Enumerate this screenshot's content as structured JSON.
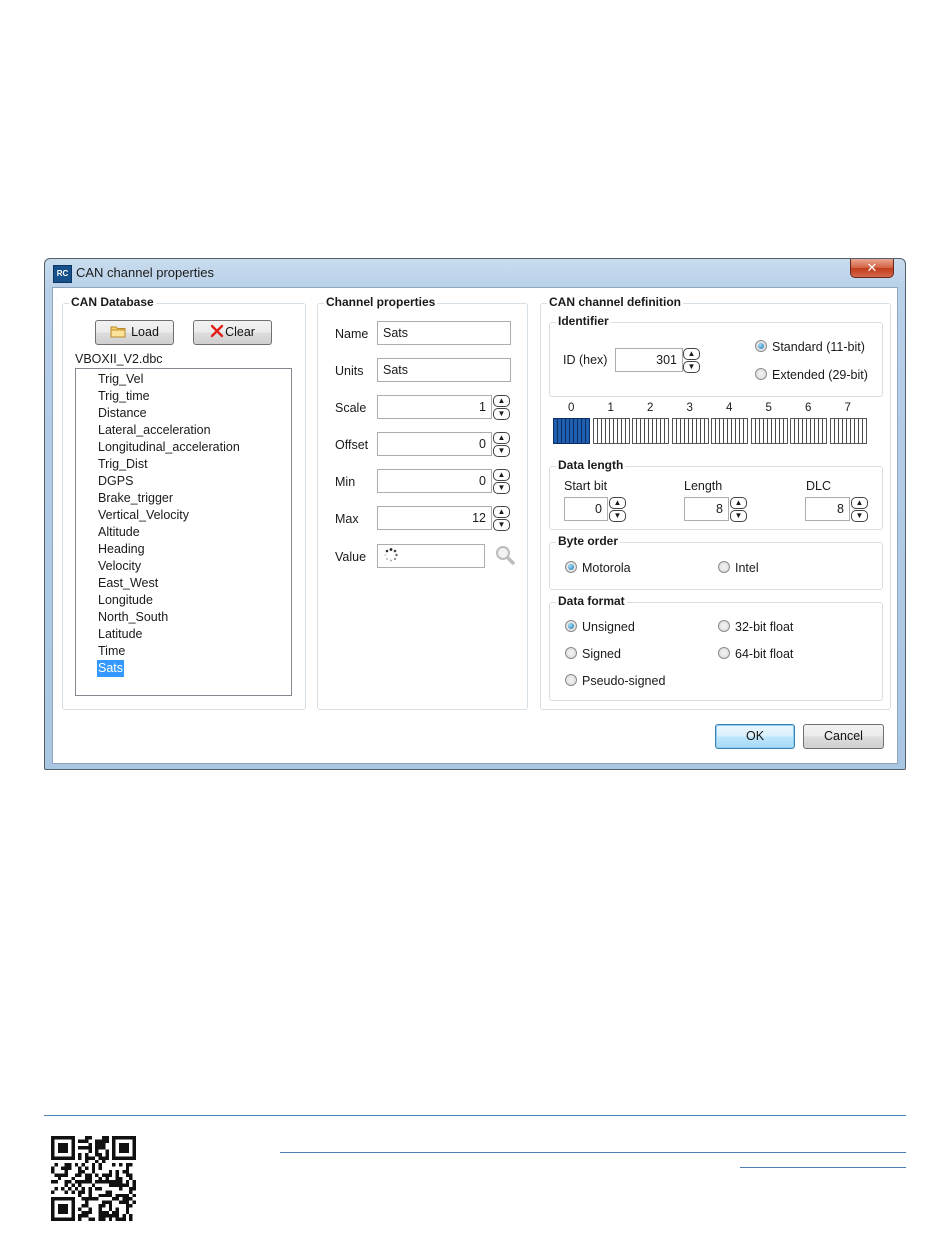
{
  "window": {
    "title": "CAN channel properties",
    "app_icon_text": "RC",
    "close_glyph": "✕"
  },
  "can_database": {
    "legend": "CAN Database",
    "load_label": "Load",
    "clear_label": "Clear",
    "file_name": "VBOXII_V2.dbc",
    "items": [
      "Trig_Vel",
      "Trig_time",
      "Distance",
      "Lateral_acceleration",
      "Longitudinal_acceleration",
      "Trig_Dist",
      "DGPS",
      "Brake_trigger",
      "Vertical_Velocity",
      "Altitude",
      "Heading",
      "Velocity",
      "East_West",
      "Longitude",
      "North_South",
      "Latitude",
      "Time",
      "Sats"
    ],
    "selected": "Sats"
  },
  "channel_properties": {
    "legend": "Channel properties",
    "name_label": "Name",
    "name_value": "Sats",
    "units_label": "Units",
    "units_value": "Sats",
    "scale_label": "Scale",
    "scale_value": "1",
    "offset_label": "Offset",
    "offset_value": "0",
    "min_label": "Min",
    "min_value": "0",
    "max_label": "Max",
    "max_value": "12",
    "value_label": "Value"
  },
  "definition": {
    "legend": "CAN channel definition",
    "identifier": {
      "legend": "Identifier",
      "id_label": "ID (hex)",
      "id_value": "301",
      "standard_label": "Standard (11-bit)",
      "extended_label": "Extended (29-bit)",
      "selected": "standard"
    },
    "bytes": [
      "0",
      "1",
      "2",
      "3",
      "4",
      "5",
      "6",
      "7"
    ],
    "active_byte": 0,
    "data_length": {
      "legend": "Data length",
      "start_bit_label": "Start bit",
      "start_bit_value": "0",
      "length_label": "Length",
      "length_value": "8",
      "dlc_label": "DLC",
      "dlc_value": "8"
    },
    "byte_order": {
      "legend": "Byte order",
      "motorola_label": "Motorola",
      "intel_label": "Intel",
      "selected": "motorola"
    },
    "data_format": {
      "legend": "Data format",
      "unsigned_label": "Unsigned",
      "signed_label": "Signed",
      "pseudo_label": "Pseudo-signed",
      "float32_label": "32-bit float",
      "float64_label": "64-bit float",
      "selected": "unsigned"
    }
  },
  "footer_buttons": {
    "ok_label": "OK",
    "cancel_label": "Cancel"
  },
  "colors": {
    "selection": "#3399ff",
    "active_byte": "#1f5fb0",
    "rule": "#4a7fb0"
  }
}
